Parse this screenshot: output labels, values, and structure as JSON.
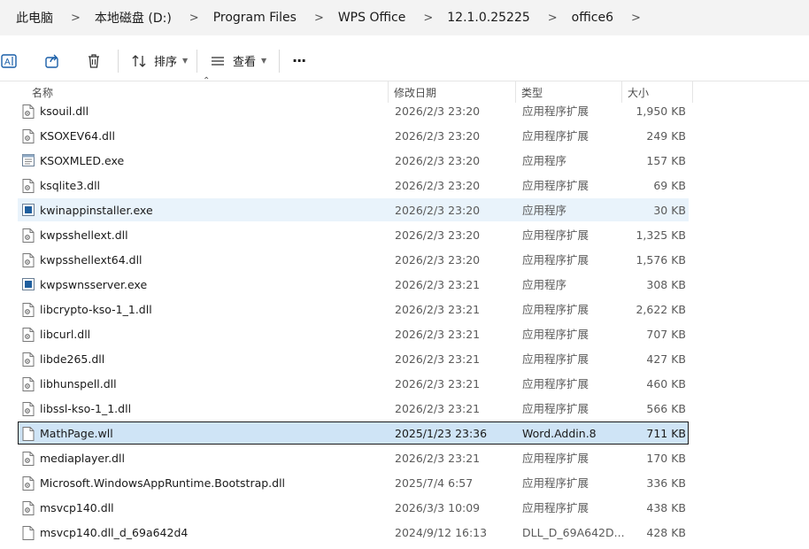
{
  "breadcrumb": [
    {
      "label": "此电脑"
    },
    {
      "label": "本地磁盘 (D:)"
    },
    {
      "label": "Program Files"
    },
    {
      "label": "WPS Office"
    },
    {
      "label": "12.1.0.25225"
    },
    {
      "label": "office6"
    }
  ],
  "toolbar": {
    "sort_label": "排序",
    "view_label": "查看",
    "more_label": "···"
  },
  "columns": {
    "name": "名称",
    "date": "修改日期",
    "type": "类型",
    "size": "大小"
  },
  "files": [
    {
      "name": "ksouil.dll",
      "date": "2026/2/3 23:20",
      "type": "应用程序扩展",
      "size": "1,950 KB",
      "icon": "dll-file-icon"
    },
    {
      "name": "KSOXEV64.dll",
      "date": "2026/2/3 23:20",
      "type": "应用程序扩展",
      "size": "249 KB",
      "icon": "dll-file-icon"
    },
    {
      "name": "KSOXMLED.exe",
      "date": "2026/2/3 23:20",
      "type": "应用程序",
      "size": "157 KB",
      "icon": "exe-window-icon"
    },
    {
      "name": "ksqlite3.dll",
      "date": "2026/2/3 23:20",
      "type": "应用程序扩展",
      "size": "69 KB",
      "icon": "dll-file-icon"
    },
    {
      "name": "kwinappinstaller.exe",
      "date": "2026/2/3 23:20",
      "type": "应用程序",
      "size": "30 KB",
      "icon": "exe-app-icon"
    },
    {
      "name": "kwpsshellext.dll",
      "date": "2026/2/3 23:20",
      "type": "应用程序扩展",
      "size": "1,325 KB",
      "icon": "dll-file-icon"
    },
    {
      "name": "kwpsshellext64.dll",
      "date": "2026/2/3 23:20",
      "type": "应用程序扩展",
      "size": "1,576 KB",
      "icon": "dll-file-icon"
    },
    {
      "name": "kwpswnsserver.exe",
      "date": "2026/2/3 23:21",
      "type": "应用程序",
      "size": "308 KB",
      "icon": "exe-app-icon"
    },
    {
      "name": "libcrypto-kso-1_1.dll",
      "date": "2026/2/3 23:21",
      "type": "应用程序扩展",
      "size": "2,622 KB",
      "icon": "dll-file-icon"
    },
    {
      "name": "libcurl.dll",
      "date": "2026/2/3 23:21",
      "type": "应用程序扩展",
      "size": "707 KB",
      "icon": "dll-file-icon"
    },
    {
      "name": "libde265.dll",
      "date": "2026/2/3 23:21",
      "type": "应用程序扩展",
      "size": "427 KB",
      "icon": "dll-file-icon"
    },
    {
      "name": "libhunspell.dll",
      "date": "2026/2/3 23:21",
      "type": "应用程序扩展",
      "size": "460 KB",
      "icon": "dll-file-icon"
    },
    {
      "name": "libssl-kso-1_1.dll",
      "date": "2026/2/3 23:21",
      "type": "应用程序扩展",
      "size": "566 KB",
      "icon": "dll-file-icon"
    },
    {
      "name": "MathPage.wll",
      "date": "2025/1/23 23:36",
      "type": "Word.Addin.8",
      "size": "711 KB",
      "icon": "blank-file-icon"
    },
    {
      "name": "mediaplayer.dll",
      "date": "2026/2/3 23:21",
      "type": "应用程序扩展",
      "size": "170 KB",
      "icon": "dll-file-icon"
    },
    {
      "name": "Microsoft.WindowsAppRuntime.Bootstrap.dll",
      "date": "2025/7/4 6:57",
      "type": "应用程序扩展",
      "size": "336 KB",
      "icon": "dll-file-icon"
    },
    {
      "name": "msvcp140.dll",
      "date": "2026/3/3 10:09",
      "type": "应用程序扩展",
      "size": "438 KB",
      "icon": "dll-file-icon"
    },
    {
      "name": "msvcp140.dll_d_69a642d4",
      "date": "2024/9/12 16:13",
      "type": "DLL_D_69A642D...",
      "size": "428 KB",
      "icon": "blank-file-icon"
    }
  ],
  "state": {
    "hover_index": 4,
    "selected_index": 13
  },
  "colors": {
    "hover_bg": "#e9f3fb",
    "selected_bg": "#cfe4f6",
    "exe_icon_blue": "#1f5f9e"
  }
}
